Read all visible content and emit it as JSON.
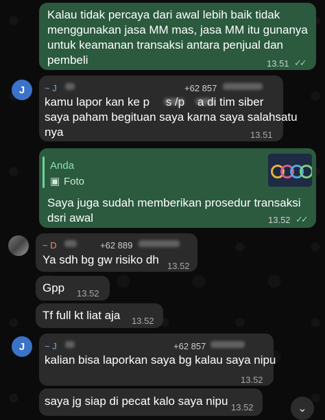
{
  "messages": [
    {
      "direction": "outgoing",
      "lines": [
        "Kalau tidak percaya dari awal lebih baik tidak",
        "menggunakan jasa MM mas, jasa MM itu gunanya",
        "untuk keamanan transaksi antara penjual dan",
        "pembeli"
      ],
      "time": "13.51"
    },
    {
      "direction": "incoming",
      "avatar": "J",
      "sender": "~ J",
      "phone": "+62 857",
      "lines": [
        "kamu lapor kan ke p     s /p    a di tim siber",
        "saya paham begituan saya karna saya salahsatu",
        "nya"
      ],
      "time": "13.51"
    },
    {
      "direction": "outgoing",
      "reply": {
        "title": "Anda",
        "subtitle": "Foto"
      },
      "lines": [
        "Saya juga sudah memberikan prosedur transaksi",
        "dsri awal"
      ],
      "time": "13.52"
    },
    {
      "direction": "incoming",
      "sender": "~ D",
      "phone": "+62 889",
      "lines": [
        "Ya sdh bg gw risiko dh"
      ],
      "time": "13.52"
    },
    {
      "direction": "incoming",
      "lines": [
        "Gpp"
      ],
      "time": "13.52"
    },
    {
      "direction": "incoming",
      "lines": [
        "Tf full kt liat aja"
      ],
      "time": "13.52"
    },
    {
      "direction": "incoming",
      "avatar": "J",
      "sender": "~ J",
      "phone": "+62 857",
      "lines": [
        "kalian bisa laporkan saya bg kalau saya nipu"
      ],
      "time": "13.52"
    },
    {
      "direction": "incoming",
      "lines": [
        "saya jg siap di pecat kalo saya nipu"
      ],
      "time": "13.52"
    }
  ],
  "icons": {
    "read_receipt": "double-check-icon",
    "photo": "photo-icon",
    "scroll_down": "chevron-down-icon"
  },
  "colors": {
    "outgoing_bubble": "#2b5a3f",
    "incoming_bubble": "#2b2b2b",
    "background": "#0b0b0b",
    "sender_j": "#7aa9e6",
    "sender_d": "#f08a7a"
  }
}
